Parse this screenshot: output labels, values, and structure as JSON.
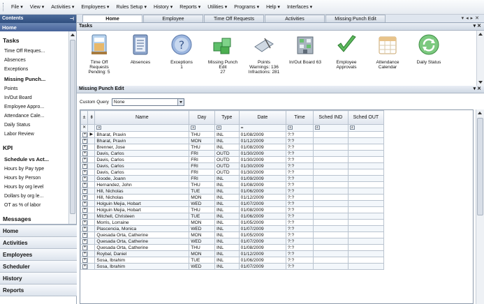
{
  "menubar": {
    "items": [
      "File ▾",
      "View ▾",
      "Activities ▾",
      "Employees ▾",
      "Rules Setup ▾",
      "History ▾",
      "Reports ▾",
      "Utilities ▾",
      "Programs ▾",
      "Help ▾",
      "Interfaces ▾"
    ]
  },
  "sidebar": {
    "contents_label": "Contents",
    "home_label": "Home",
    "tasks_heading": "Tasks",
    "task_links": [
      "Time Off Reques...",
      "Absences",
      "Exceptions",
      "Missing Punch...",
      "Points",
      "In/Out Board",
      "Employee Appro...",
      "Attendance Cale...",
      "Daily Status",
      "Labor Review"
    ],
    "kpi_heading": "KPI",
    "kpi_links": [
      "Schedule vs Act...",
      "Hours by Pay type",
      "Hours by Person",
      "Hours by org level",
      "Dollars by org le...",
      "OT as % of labor"
    ],
    "messages_heading": "Messages",
    "nav_buttons": [
      "Home",
      "Activities",
      "Employees",
      "Scheduler",
      "History",
      "Reports"
    ]
  },
  "tabs": [
    "Home",
    "Employee",
    "Time Off Requests",
    "Activities",
    "Missing Punch Edit"
  ],
  "tasks_panel": {
    "title": "Tasks",
    "items": [
      {
        "label": "Time Off\nRequests\nPending: 5",
        "icon": "calendar-notebook-icon"
      },
      {
        "label": "Absences",
        "icon": "document-list-icon"
      },
      {
        "label": "Exceptions\n1",
        "icon": "question-mark-icon"
      },
      {
        "label": "Missing Punch\nEdit\n27",
        "icon": "green-blocks-icon"
      },
      {
        "label": "Points\nWarnings: 136\nInfractions: 281",
        "icon": "tablet-pen-icon"
      },
      {
        "label": "In/Out Board 63",
        "icon": "building-icon"
      },
      {
        "label": "Employee\nApprovals",
        "icon": "checkmark-icon"
      },
      {
        "label": "Attendance\nCalendar",
        "icon": "calendar-icon"
      },
      {
        "label": "Daily Status",
        "icon": "refresh-arrows-icon"
      }
    ]
  },
  "missing_punch_panel": {
    "title": "Missing Punch Edit",
    "custom_query_label": "Custom Query",
    "custom_query_value": "None",
    "columns": [
      "Name",
      "Day",
      "Type",
      "Date",
      "Time",
      "Sched IND",
      "Sched OUT"
    ],
    "rows": [
      {
        "name": "Bharat, Pravin",
        "day": "THU",
        "type": "INL",
        "date": "01/08/2009",
        "time": "?:?"
      },
      {
        "name": "Bharat, Pravin",
        "day": "MON",
        "type": "INL",
        "date": "01/12/2009",
        "time": "?:?"
      },
      {
        "name": "Brenner, Jose",
        "day": "THU",
        "type": "INL",
        "date": "01/08/2009",
        "time": "?:?"
      },
      {
        "name": "Davis, Carlos",
        "day": "FRI",
        "type": "OUTD",
        "date": "01/30/2009",
        "time": "?:?"
      },
      {
        "name": "Davis, Carlos",
        "day": "FRI",
        "type": "OUTD",
        "date": "01/30/2009",
        "time": "?:?"
      },
      {
        "name": "Davis, Carlos",
        "day": "FRI",
        "type": "OUTD",
        "date": "01/30/2009",
        "time": "?:?"
      },
      {
        "name": "Davis, Carlos",
        "day": "FRI",
        "type": "OUTD",
        "date": "01/30/2009",
        "time": "?:?"
      },
      {
        "name": "Goode, Joann",
        "day": "FRI",
        "type": "INL",
        "date": "01/09/2009",
        "time": "?:?"
      },
      {
        "name": "Hernandez, John",
        "day": "THU",
        "type": "INL",
        "date": "01/08/2009",
        "time": "?:?"
      },
      {
        "name": "Hill, Nicholas",
        "day": "TUE",
        "type": "INL",
        "date": "01/06/2009",
        "time": "?:?"
      },
      {
        "name": "Hill, Nicholas",
        "day": "MON",
        "type": "INL",
        "date": "01/12/2009",
        "time": "?:?"
      },
      {
        "name": "Holguin Mejia, Hobart",
        "day": "WED",
        "type": "INL",
        "date": "01/07/2009",
        "time": "?:?"
      },
      {
        "name": "Holguin Mejia, Hobart",
        "day": "THU",
        "type": "INL",
        "date": "01/08/2009",
        "time": "?:?"
      },
      {
        "name": "Mitchell, Christeen",
        "day": "TUE",
        "type": "INL",
        "date": "01/06/2009",
        "time": "?:?"
      },
      {
        "name": "Morris, Lorraine",
        "day": "MON",
        "type": "INL",
        "date": "01/05/2009",
        "time": "?:?"
      },
      {
        "name": "Plascencia, Monica",
        "day": "WED",
        "type": "INL",
        "date": "01/07/2009",
        "time": "?:?"
      },
      {
        "name": "Quesada Orta, Catherine",
        "day": "MON",
        "type": "INL",
        "date": "01/05/2009",
        "time": "?:?"
      },
      {
        "name": "Quesada Orta, Catherine",
        "day": "WED",
        "type": "INL",
        "date": "01/07/2009",
        "time": "?:?"
      },
      {
        "name": "Quesada Orta, Catherine",
        "day": "THU",
        "type": "INL",
        "date": "01/08/2009",
        "time": "?:?"
      },
      {
        "name": "Roybal, Daniel",
        "day": "MON",
        "type": "INL",
        "date": "01/12/2009",
        "time": "?:?"
      },
      {
        "name": "Sosa, Ibrahim",
        "day": "TUE",
        "type": "INL",
        "date": "01/06/2009",
        "time": "?:?"
      },
      {
        "name": "Sosa, Ibrahim",
        "day": "WED",
        "type": "INL",
        "date": "01/07/2009",
        "time": "?:?"
      }
    ],
    "filter_date_op": "="
  },
  "colors": {
    "header_blue": "#2f4e7f",
    "accent_green": "#4caf50"
  }
}
